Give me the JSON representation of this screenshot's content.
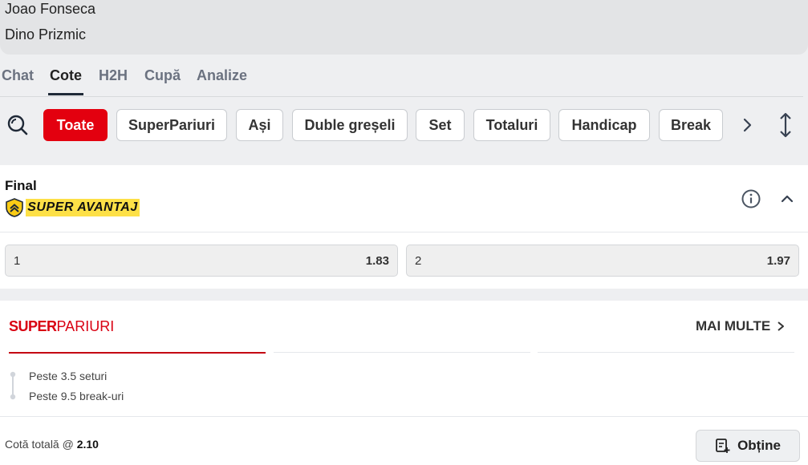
{
  "match": {
    "player1": "Joao Fonseca",
    "player2": "Dino Prizmic"
  },
  "tabs": [
    {
      "label": "Chat",
      "active": false
    },
    {
      "label": "Cote",
      "active": true
    },
    {
      "label": "H2H",
      "active": false
    },
    {
      "label": "Cupă",
      "active": false
    },
    {
      "label": "Analize",
      "active": false
    }
  ],
  "filters": [
    {
      "label": "Toate",
      "active": true
    },
    {
      "label": "SuperPariuri",
      "active": false
    },
    {
      "label": "Ași",
      "active": false
    },
    {
      "label": "Duble greșeli",
      "active": false
    },
    {
      "label": "Set",
      "active": false
    },
    {
      "label": "Totaluri",
      "active": false
    },
    {
      "label": "Handicap",
      "active": false
    },
    {
      "label": "Break",
      "active": false
    }
  ],
  "market": {
    "title": "Final",
    "badge": "SUPER AVANTAJ",
    "odds": [
      {
        "selection": "1",
        "price": "1.83"
      },
      {
        "selection": "2",
        "price": "1.97"
      }
    ]
  },
  "superpariuri": {
    "logo_bold": "SUPER",
    "logo_rest": "PARIURI",
    "more_label": "MAI MULTE",
    "legs": [
      "Peste 3.5 seturi",
      "Peste 9.5 break-uri"
    ],
    "total_label": "Cotă totală @",
    "total_value": "2.10",
    "cta_label": "Obține"
  },
  "colors": {
    "accent": "#e3000f",
    "badge": "#fde047",
    "page_bg": "#eeeff1"
  },
  "icons": [
    "search-icon",
    "chevron-right-icon",
    "expand-vertical-icon",
    "shield-icon",
    "info-icon",
    "chevron-up-icon",
    "betslip-add-icon"
  ]
}
